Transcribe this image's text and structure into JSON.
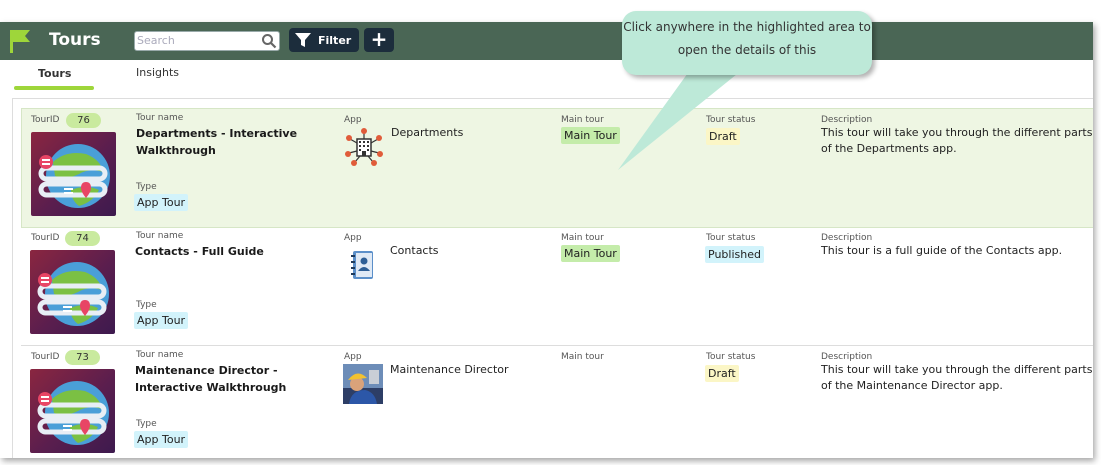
{
  "header": {
    "title": "Tours",
    "search_placeholder": "Search",
    "filter_label": "Filter",
    "add_label": "+"
  },
  "tabs": [
    {
      "label": "Tours",
      "active": true
    },
    {
      "label": "Insights",
      "active": false
    }
  ],
  "field_labels": {
    "tour_id": "TourID",
    "tour_name": "Tour name",
    "type": "Type",
    "app": "App",
    "main_tour": "Main tour",
    "tour_status": "Tour status",
    "description": "Description"
  },
  "rows": [
    {
      "id": "76",
      "name": "Departments - Interactive Walkthrough",
      "type": "App Tour",
      "app": "Departments",
      "main_tour": "Main Tour",
      "status": "Draft",
      "description": "This tour will take you through the different parts of the Departments app."
    },
    {
      "id": "74",
      "name": "Contacts - Full Guide",
      "type": "App Tour",
      "app": "Contacts",
      "main_tour": "Main Tour",
      "status": "Published",
      "description": "This tour is a full guide of the Contacts app."
    },
    {
      "id": "73",
      "name": "Maintenance Director - Interactive Walkthrough",
      "type": "App Tour",
      "app": "Maintenance Director",
      "main_tour": "",
      "status": "Draft",
      "description": "This tour will take you through the different parts of the Maintenance Director app."
    }
  ],
  "callout": {
    "text": "Click anywhere in the highlighted area to open the details of this"
  },
  "colors": {
    "topbar": "#4a6655",
    "accent": "#9ed63a",
    "highlight_row": "#eef6e3",
    "callout": "#bde9d8"
  }
}
